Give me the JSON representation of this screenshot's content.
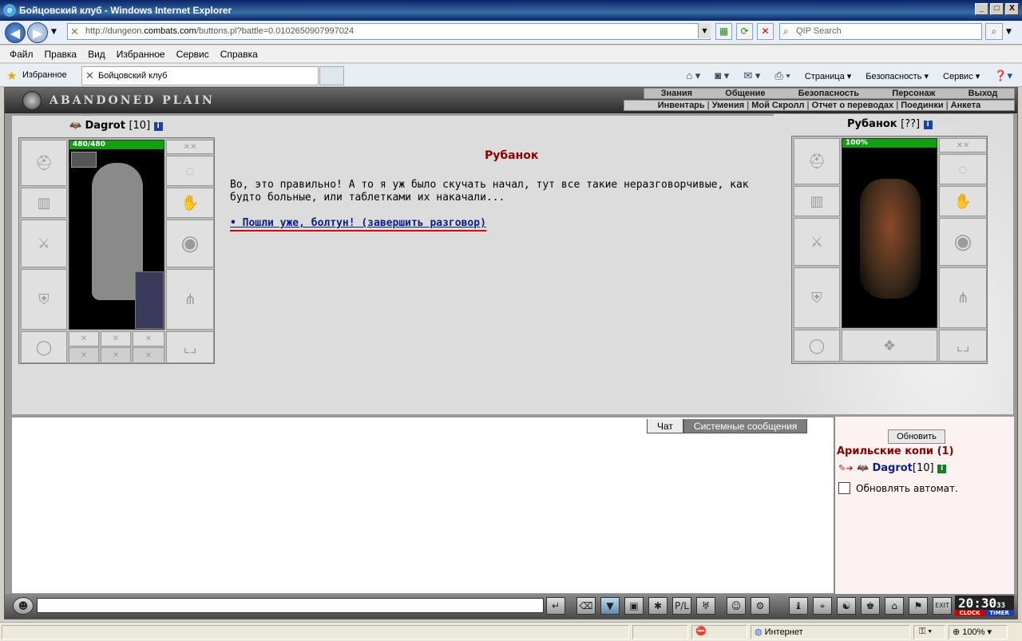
{
  "window": {
    "title": "Бойцовский клуб - Windows Internet Explorer",
    "min": "_",
    "max": "□",
    "close": "X"
  },
  "address": {
    "prefix": "http://dungeon.",
    "domain": "combats.com",
    "suffix": "/buttons.pl?battle=0.0102650907997024",
    "search_placeholder": "QIP Search"
  },
  "menu": [
    "Файл",
    "Правка",
    "Вид",
    "Избранное",
    "Сервис",
    "Справка"
  ],
  "favorites": {
    "label": "Избранное",
    "tab_title": "Бойцовский клуб"
  },
  "commandbar": {
    "page": "Страница",
    "safety": "Безопасность",
    "service": "Сервис"
  },
  "game": {
    "logo": "ABANDONED PLAIN",
    "topmenu": [
      "Знания",
      "Общение",
      "Безопасность",
      "Персонаж",
      "Выход"
    ],
    "submenu": [
      "Инвентарь",
      "Умения",
      "Мой Скролл",
      "Отчет о переводах",
      "Поединки",
      "Анкета"
    ],
    "player": {
      "name": "Dagrot",
      "level": "[10]",
      "hp": "480/480",
      "info": "i"
    },
    "npc": {
      "name": "Рубанок",
      "level": "[??]",
      "hp": "100%",
      "info": "i"
    },
    "dialog": {
      "title": "Рубанок",
      "text": "Во, это правильно! А то я уж было скучать начал, тут все такие неразговорчивые, как будто больные, или таблетками их накачали...",
      "link": "• Пошли уже, болтун! (завершить разговор)"
    },
    "chat": {
      "tab_chat": "Чат",
      "tab_system": "Системные сообщения"
    },
    "right": {
      "refresh": "Обновить",
      "location": "Арильские копи (1)",
      "user_name": "Dagrot",
      "user_level": "[10]",
      "auto_refresh": "Обновлять автомат."
    },
    "clock": {
      "time": "20:30",
      "seconds": "33",
      "clock_label": "CLOCK",
      "timer_label": "TIMER"
    }
  },
  "status": {
    "zone": "Интернет",
    "zoom": "100%"
  }
}
